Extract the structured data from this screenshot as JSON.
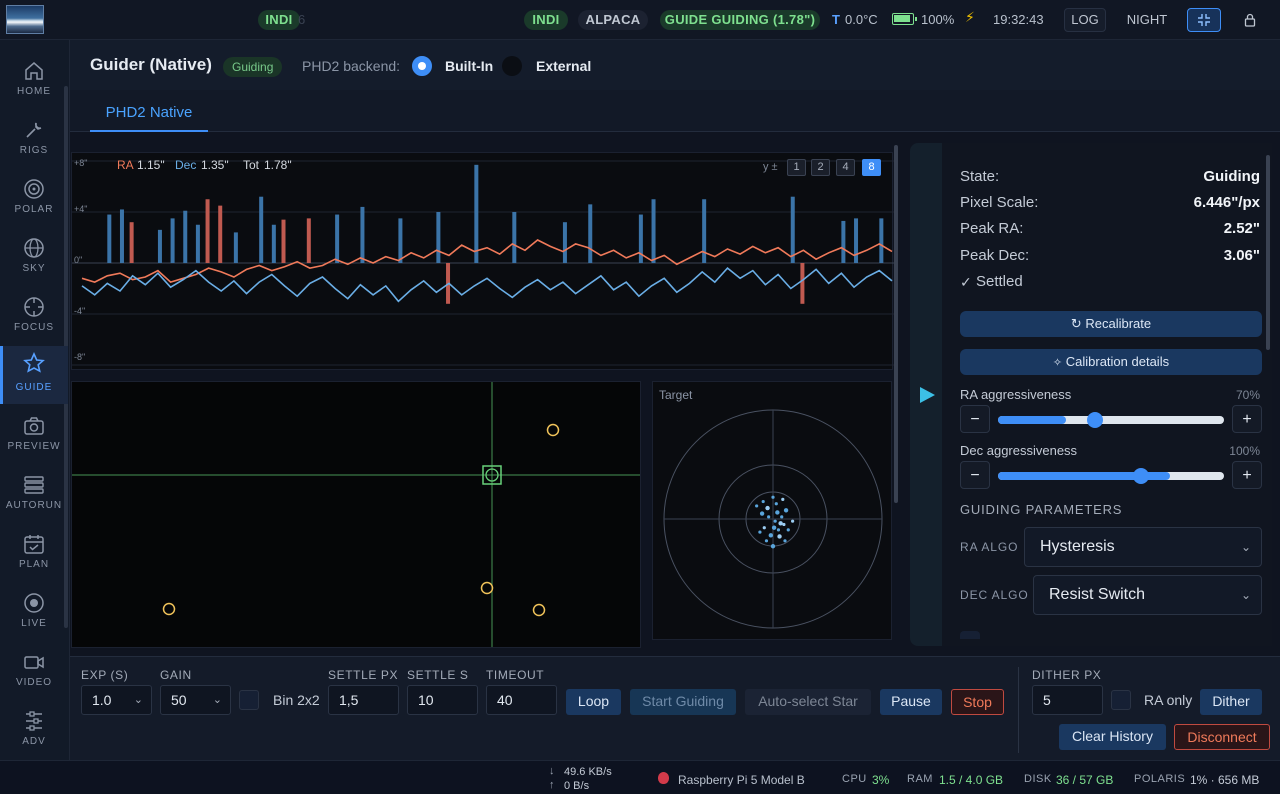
{
  "topbar": {
    "indi_ghost": "INDI",
    "ghost_suffix": "6",
    "pills": [
      "INDI",
      "ALPACA",
      "GUIDE GUIDING (1.78\")"
    ],
    "temp_prefix": "T",
    "temp": "0.0°C",
    "battery": "100%",
    "time": "19:32:43",
    "log": "LOG",
    "night": "NIGHT",
    "colors": {
      "accent": "#3e8ef7",
      "ok": "#7ee08f"
    }
  },
  "sidebar": {
    "items": [
      {
        "label": "HOME",
        "icon": "home-icon"
      },
      {
        "label": "RIGS",
        "icon": "wrench-icon"
      },
      {
        "label": "POLAR",
        "icon": "target-icon"
      },
      {
        "label": "SKY",
        "icon": "globe-icon"
      },
      {
        "label": "FOCUS",
        "icon": "crosshair-icon"
      },
      {
        "label": "GUIDE",
        "icon": "star-icon",
        "active": true
      },
      {
        "label": "PREVIEW",
        "icon": "camera-icon"
      },
      {
        "label": "AUTORUN",
        "icon": "list-icon"
      },
      {
        "label": "PLAN",
        "icon": "calendar-icon"
      },
      {
        "label": "LIVE",
        "icon": "record-icon"
      },
      {
        "label": "VIDEO",
        "icon": "video-icon"
      },
      {
        "label": "ADV",
        "icon": "sliders-icon"
      }
    ]
  },
  "header": {
    "title": "Guider (Native)",
    "status_badge": "Guiding",
    "backend_label": "PHD2 backend:",
    "builtin": "Built-In",
    "external": "External"
  },
  "tabs": [
    "PHD2 Native"
  ],
  "graph": {
    "ra_label": "RA",
    "ra_value": "1.15\"",
    "dec_label": "Dec",
    "dec_value": "1.35\"",
    "tot_label": "Tot",
    "tot_value": "1.78\"",
    "y_prefix": "y ±",
    "scales": [
      "1",
      "2",
      "4",
      "8"
    ],
    "active_scale": "8",
    "y_ticks": [
      "+8\"",
      "+4\"",
      "0\"",
      "-4\"",
      "-8\""
    ]
  },
  "chart_data": {
    "type": "line",
    "ylim": [
      -8,
      8
    ],
    "series": [
      {
        "name": "RA",
        "color": "#f07a5a",
        "values": [
          -1.2,
          -1.5,
          -1.0,
          -0.8,
          -1.3,
          -1.1,
          -0.6,
          -1.5,
          -1.2,
          -0.9,
          -0.4,
          -0.7,
          -1.1,
          -0.5,
          -0.2,
          -0.6,
          -0.3,
          0.1,
          -0.4,
          -0.2,
          0.3,
          -0.1,
          0.4,
          0.0,
          0.5,
          0.2,
          0.8,
          0.4,
          1.0,
          0.6,
          1.4,
          0.9,
          1.2,
          0.7,
          1.5,
          1.0,
          1.8,
          1.3,
          0.9,
          1.5,
          1.2,
          0.6,
          1.0,
          0.4,
          0.8,
          0.2,
          0.6,
          -0.1,
          0.4,
          0.9,
          0.5,
          1.1,
          0.7,
          1.3,
          0.8,
          1.2,
          0.5,
          1.0,
          0.3,
          0.8,
          1.2,
          0.6,
          1.0,
          1.5,
          0.9
        ]
      },
      {
        "name": "Dec",
        "color": "#6aaee6",
        "values": [
          -1.8,
          -2.5,
          -1.6,
          -2.2,
          -1.0,
          -1.7,
          -0.8,
          -1.9,
          -1.3,
          -0.6,
          -1.5,
          -2.2,
          -1.4,
          -2.4,
          -1.5,
          -0.9,
          -1.8,
          -2.6,
          -1.6,
          -1.1,
          -2.0,
          -2.8,
          -1.7,
          -2.5,
          -1.8,
          -3.0,
          -2.1,
          -1.4,
          -2.3,
          -1.6,
          -2.5,
          -1.8,
          -1.2,
          -2.0,
          -2.7,
          -1.9,
          -1.3,
          -2.1,
          -1.5,
          -2.4,
          -1.7,
          -1.0,
          -2.1,
          -1.5,
          -2.6,
          -1.8,
          -1.2,
          -2.3,
          -1.6,
          -0.7,
          -1.5,
          -0.4,
          -1.2,
          -0.6,
          -1.7,
          -0.9,
          -2.0,
          -1.3,
          -0.5,
          -1.6,
          -0.8,
          -1.9,
          -1.1,
          -0.6,
          -1.4
        ]
      }
    ],
    "bars": {
      "ra_color": "#c05a50",
      "dec_color": "#3b74a8",
      "x_index": [
        2,
        3,
        4,
        6,
        7,
        8,
        9,
        10,
        11,
        12,
        14,
        15,
        16,
        18,
        20,
        22,
        25,
        28,
        29,
        31,
        34,
        38,
        40,
        44,
        45,
        49,
        54,
        56,
        57,
        60,
        61,
        63
      ],
      "ra_values": [
        0,
        0,
        3.2,
        0,
        0,
        0,
        0,
        5.0,
        4.5,
        0,
        0,
        0,
        3.4,
        3.5,
        0,
        0,
        0,
        0,
        -3.2,
        0,
        0,
        0,
        0,
        0,
        0,
        0,
        0,
        0,
        -3.2,
        0,
        0,
        0
      ],
      "dec_values": [
        3.8,
        4.2,
        0,
        2.6,
        3.5,
        4.1,
        3.0,
        0,
        0,
        2.4,
        5.2,
        3.0,
        0,
        0,
        3.8,
        4.4,
        3.5,
        4.0,
        0,
        7.7,
        4.0,
        3.2,
        4.6,
        3.8,
        5.0,
        5.0,
        0,
        5.2,
        0,
        3.3,
        3.5,
        3.5
      ]
    }
  },
  "camera": {
    "target_label": "Target"
  },
  "target_plot": {
    "points": [
      [
        -0.05,
        -0.1
      ],
      [
        0.03,
        -0.14
      ],
      [
        0.0,
        -0.2
      ],
      [
        -0.1,
        -0.05
      ],
      [
        0.1,
        0.05
      ],
      [
        0.05,
        0.1
      ],
      [
        -0.02,
        0.15
      ],
      [
        0.08,
        -0.02
      ],
      [
        -0.08,
        0.08
      ],
      [
        0.12,
        -0.08
      ],
      [
        0.02,
        0.02
      ],
      [
        -0.04,
        -0.02
      ],
      [
        0.06,
        0.16
      ],
      [
        -0.12,
        0.12
      ],
      [
        0.14,
        0.1
      ],
      [
        0.0,
        0.25
      ],
      [
        0.09,
        -0.18
      ],
      [
        -0.15,
        -0.12
      ],
      [
        0.04,
        -0.06
      ],
      [
        -0.06,
        0.2
      ],
      [
        0.18,
        0.02
      ],
      [
        0.01,
        0.08
      ],
      [
        0.11,
        0.2
      ],
      [
        -0.09,
        -0.16
      ],
      [
        0.07,
        0.04
      ]
    ]
  },
  "right": {
    "state_label": "State:",
    "state_value": "Guiding",
    "pixel_label": "Pixel Scale:",
    "pixel_value": "6.446\"/px",
    "peakra_label": "Peak RA:",
    "peakra_value": "2.52\"",
    "peakdec_label": "Peak Dec:",
    "peakdec_value": "3.06\"",
    "settled": "Settled",
    "recalibrate": "Recalibrate",
    "calib_details": "Calibration details",
    "ra_aggr_label": "RA aggressiveness",
    "ra_aggr_pct": "70%",
    "ra_aggr": 0.7,
    "dec_aggr_label": "Dec aggressiveness",
    "dec_aggr_pct": "100%",
    "dec_aggr": 1.0,
    "params_title": "GUIDING PARAMETERS",
    "ra_algo_label": "RA ALGO",
    "ra_algo": "Hysteresis",
    "dec_algo_label": "DEC ALGO",
    "dec_algo": "Resist Switch"
  },
  "bottom": {
    "exp_label": "EXP (S)",
    "exp": "1.0",
    "gain_label": "GAIN",
    "gain": "50",
    "bin_label": "Bin 2x2",
    "settle_px_label": "SETTLE PX",
    "settle_px": "1,5",
    "settle_s_label": "SETTLE S",
    "settle_s": "10",
    "timeout_label": "TIMEOUT",
    "timeout": "40",
    "loop": "Loop",
    "start": "Start Guiding",
    "auto": "Auto-select Star",
    "pause": "Pause",
    "stop": "Stop",
    "dither_px_label": "DITHER PX",
    "dither_px": "5",
    "ra_only": "RA only",
    "dither": "Dither",
    "clear": "Clear History",
    "disconnect": "Disconnect"
  },
  "status": {
    "down": "49.6 KB/s",
    "up": "0 B/s",
    "device": "Raspberry Pi 5 Model B",
    "cpu_label": "CPU",
    "cpu": "3%",
    "ram_label": "RAM",
    "ram": "1.5 / 4.0 GB",
    "disk_label": "DISK",
    "disk": "36 / 57 GB",
    "polaris_label": "POLARIS",
    "polaris": "1% · 656 MB"
  }
}
